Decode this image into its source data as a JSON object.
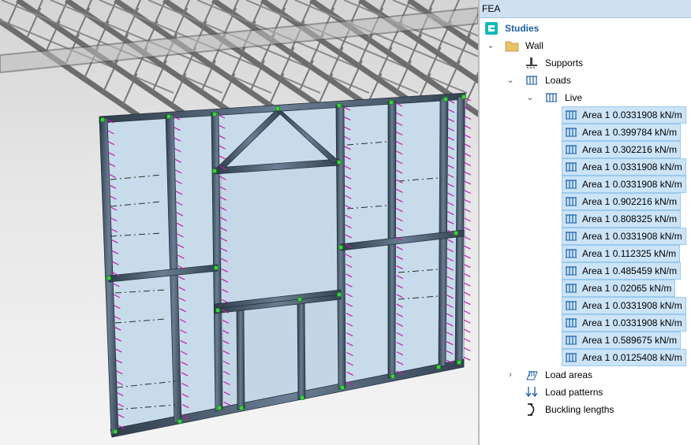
{
  "panel": {
    "title": "FEA",
    "tree": {
      "root": "Studies",
      "wall": "Wall",
      "supports": "Supports",
      "loads": "Loads",
      "live": "Live",
      "live_items": [
        "Area 1 0.0331908 kN/m",
        "Area 1 0.399784 kN/m",
        "Area 1 0.302216 kN/m",
        "Area 1 0.0331908 kN/m",
        "Area 1 0.0331908 kN/m",
        "Area 1 0.902216 kN/m",
        "Area 1 0.808325 kN/m",
        "Area 1 0.0331908 kN/m",
        "Area 1 0.112325 kN/m",
        "Area 1 0.485459 kN/m",
        "Area 1 0.02065 kN/m",
        "Area 1 0.0331908 kN/m",
        "Area 1 0.0331908 kN/m",
        "Area 1 0.589675 kN/m",
        "Area 1 0.0125408 kN/m"
      ],
      "load_areas": "Load areas",
      "load_patterns": "Load patterns",
      "buckling_lengths": "Buckling lengths"
    }
  },
  "colors": {
    "selection_fill": "#cce4f7",
    "selection_border": "#99c9ef",
    "studies_icon": "#12b8b8",
    "load_arrow": "#c21fb0",
    "steel_frame": "#53667a",
    "panel_fill": "#c7d9e8"
  },
  "icons": {
    "studies": "studies-icon",
    "wall": "folder-icon",
    "supports": "support-icon",
    "loads": "distributed-load-icon",
    "load_areas": "load-area-icon",
    "load_patterns": "load-pattern-icon",
    "buckling": "buckling-icon"
  }
}
